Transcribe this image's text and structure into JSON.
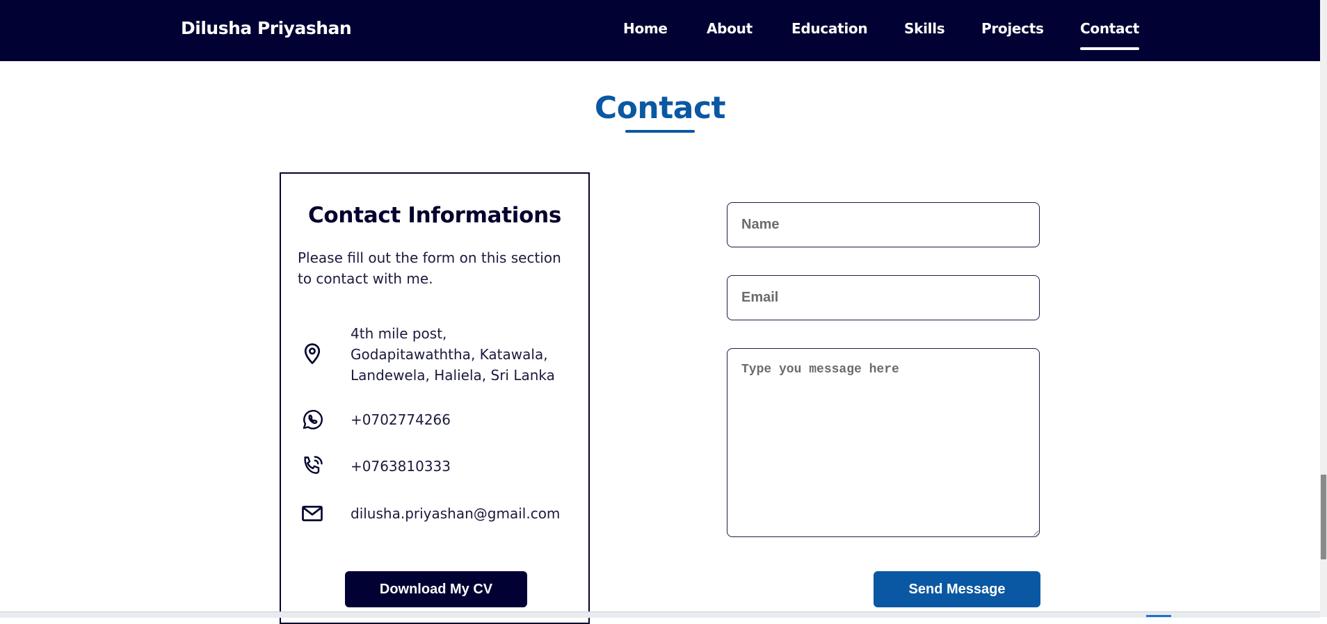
{
  "header": {
    "brand": "Dilusha Priyashan",
    "nav": [
      {
        "label": "Home"
      },
      {
        "label": "About"
      },
      {
        "label": "Education"
      },
      {
        "label": "Skills"
      },
      {
        "label": "Projects"
      },
      {
        "label": "Contact",
        "active": true
      }
    ]
  },
  "section": {
    "title": "Contact"
  },
  "info_card": {
    "title": "Contact Informations",
    "description": "Please fill out the form on this section to contact with me.",
    "address_lines": [
      "4th mile post,",
      "Godapitawaththa, Katawala,",
      "Landewela, Haliela, Sri Lanka"
    ],
    "whatsapp": "+0702774266",
    "phone": "+0763810333",
    "email": "dilusha.priyashan@gmail.com",
    "download_button": "Download My CV"
  },
  "form": {
    "name_placeholder": "Name",
    "email_placeholder": "Email",
    "message_placeholder": "Type you message here",
    "send_button": "Send Message"
  },
  "icons": {
    "address": "location-pin-icon",
    "whatsapp": "whatsapp-icon",
    "phone": "phone-call-icon",
    "email": "mail-icon"
  },
  "colors": {
    "navbar": "#010133",
    "accent": "#0a58a3",
    "text": "#02022e"
  }
}
